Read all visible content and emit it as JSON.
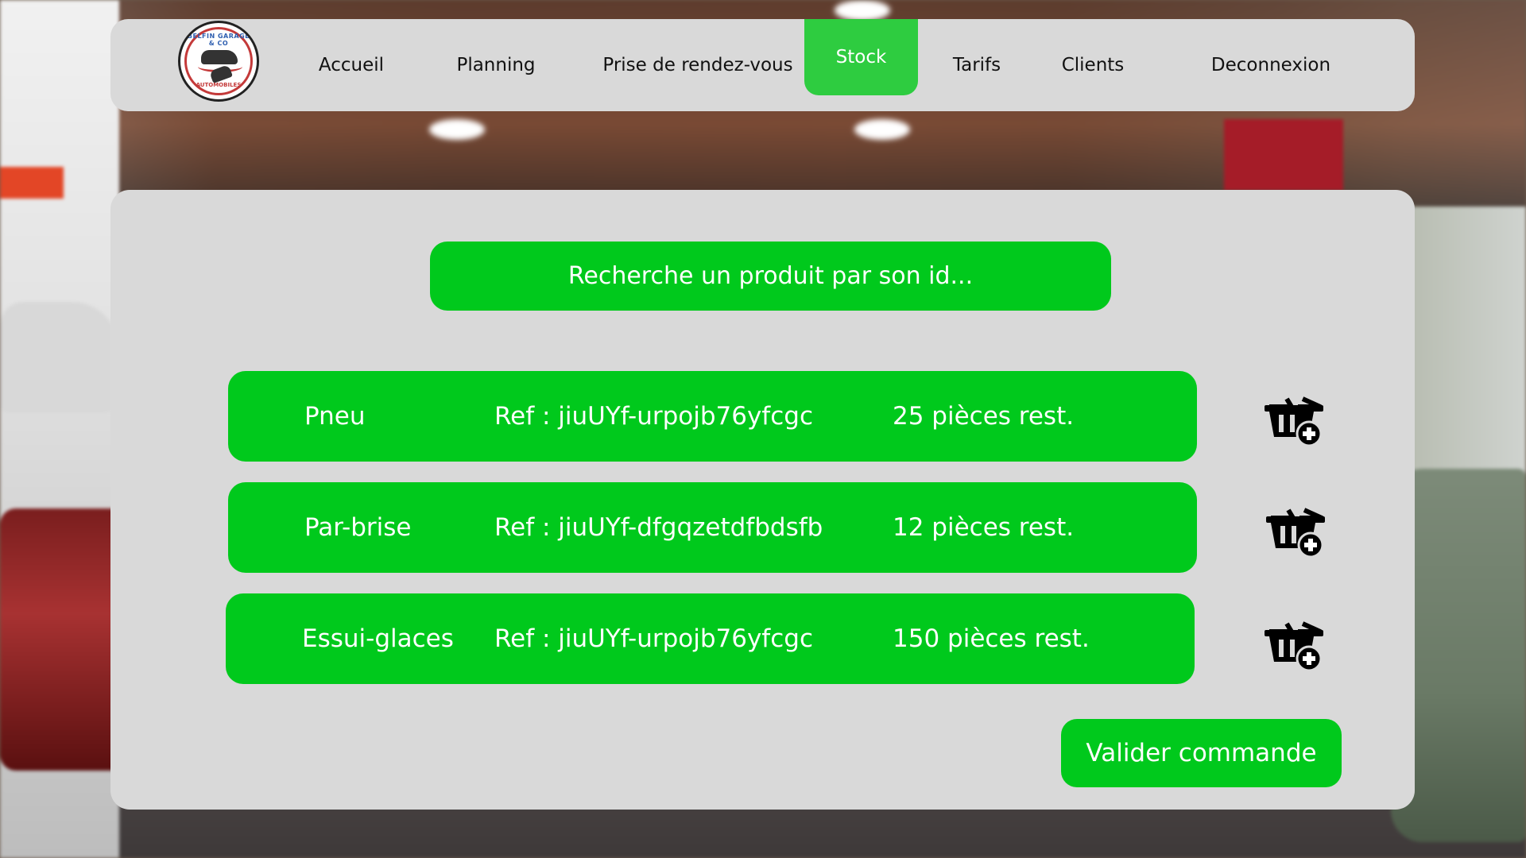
{
  "logo": {
    "text_top": "BELFIN GARAGE & CO",
    "text_bottom": "AUTOMOBILES"
  },
  "nav": {
    "items": [
      {
        "label": "Accueil"
      },
      {
        "label": "Planning"
      },
      {
        "label": "Prise de rendez-vous"
      },
      {
        "label": "Stock",
        "active": true
      },
      {
        "label": "Tarifs"
      },
      {
        "label": "Clients"
      },
      {
        "label": "Deconnexion"
      }
    ]
  },
  "search": {
    "placeholder": "Recherche un produit par son id..."
  },
  "products": [
    {
      "name": "Pneu",
      "ref": "Ref : jiuUYf-urpojb76yfcgc",
      "qty": "25 pièces rest."
    },
    {
      "name": "Par-brise",
      "ref": "Ref : jiuUYf-dfgqzetdfbdsfb",
      "qty": "12 pièces rest."
    },
    {
      "name": "Essui-glaces",
      "ref": "Ref : jiuUYf-urpojb76yfcgc",
      "qty": "150 pièces rest."
    }
  ],
  "actions": {
    "validate_label": "Valider commande",
    "add_to_cart_icon": "basket-add-icon"
  },
  "colors": {
    "accent_green": "#00c91c",
    "active_tab": "#2ecc40",
    "panel_bg": "#d9d9d9"
  }
}
